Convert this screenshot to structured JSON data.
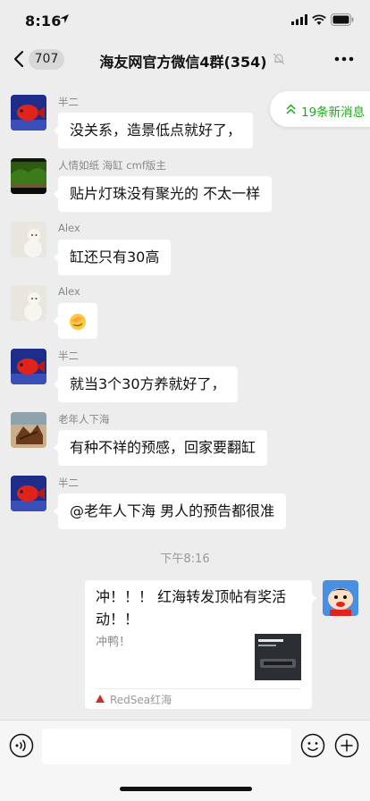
{
  "status_bar": {
    "time": "8:16"
  },
  "nav": {
    "unread_count": "707",
    "title": "海友网官方微信4群(354)"
  },
  "new_messages": {
    "label": "19条新消息"
  },
  "messages": [
    {
      "sender": "半二",
      "text": "没关系，造景低点就好了，",
      "avatar": "red-fish"
    },
    {
      "sender": "人情如纸 海缸 cmf版主",
      "text": "贴片灯珠没有聚光的  不太一样",
      "avatar": "aquarium-plants"
    },
    {
      "sender": "Alex",
      "text": "缸还只有30高",
      "avatar": "white-cat"
    },
    {
      "sender": "Alex",
      "text": "",
      "avatar": "white-cat",
      "emoji": "facepalm-emoji"
    },
    {
      "sender": "半二",
      "text": "就当3个30方养就好了，",
      "avatar": "red-fish"
    },
    {
      "sender": "老年人下海",
      "text": "有种不祥的预感，回家要翻缸",
      "avatar": "old-man-sea"
    },
    {
      "sender": "半二",
      "text": "@老年人下海 男人的预告都很准",
      "avatar": "red-fish"
    }
  ],
  "time_divider": "下午8:16",
  "link_card": {
    "title": "冲！！！ 红海转发顶帖有奖活动！！",
    "description": "冲鸭！",
    "source": "RedSea红海"
  },
  "input": {
    "placeholder": ""
  },
  "colors": {
    "accent_green": "#1aad19",
    "bubble": "#ffffff",
    "background": "#ededed"
  }
}
